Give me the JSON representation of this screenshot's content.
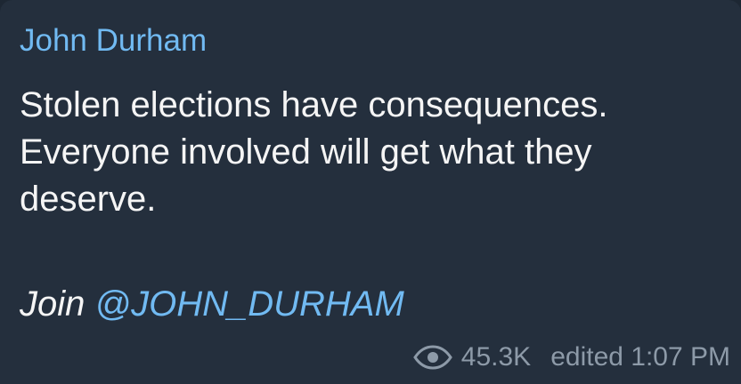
{
  "message": {
    "sender": "John Durham",
    "body_lines": [
      "Stolen elections have consequences.",
      "Everyone involved will get what they",
      "deserve."
    ],
    "join_prefix": "Join ",
    "mention": "@JOHN_DURHAM",
    "views": "45.3K",
    "edited_time": "edited 1:07 PM"
  },
  "colors": {
    "bubble_background": "#242f3d",
    "sender": "#71baf2",
    "text": "#f5f5f5",
    "meta": "#8d9aa8"
  },
  "icons": {
    "views": "eye-icon"
  }
}
